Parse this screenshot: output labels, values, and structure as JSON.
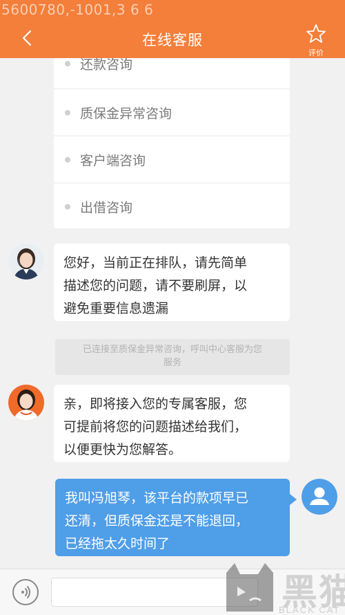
{
  "status_bar": {
    "overlay_text": "5600780,-1001,3 6 6"
  },
  "header": {
    "title": "在线客服",
    "rate_label": "评价",
    "bg_color": "#f37f3b"
  },
  "menu": {
    "items": [
      {
        "label": "还款咨询"
      },
      {
        "label": "质保金异常咨询"
      },
      {
        "label": "客户端咨询"
      },
      {
        "label": "出借咨询"
      }
    ]
  },
  "messages": {
    "agent1": {
      "lines": [
        "您好，当前正在排队，请先简单",
        "描述您的问题，请不要刷屏，以",
        "避免重要信息遗漏"
      ]
    },
    "system_notice": {
      "lines": [
        "已连接至质保金异常咨询，呼叫中心客服为您",
        "服务"
      ]
    },
    "agent2": {
      "lines": [
        "亲，即将接入您的专属客服，您",
        "可提前将您的问题描述给我们，",
        "以便更快为您解答。"
      ]
    },
    "user1": {
      "lines": [
        "我叫冯旭琴，该平台的款项早已",
        "还清，但质保金还是不能退回，",
        "已经拖太久时间了"
      ],
      "bubble_color": "#4f9ee8"
    }
  },
  "composer": {
    "placeholder": ""
  },
  "watermark": {
    "cn_text": "黑猫",
    "en_text": "BLACK CAT"
  },
  "icons": {
    "back": "chevron-left-icon",
    "rate": "star-icon",
    "voice": "voice-icon",
    "user_avatar": "user-avatar-icon"
  }
}
